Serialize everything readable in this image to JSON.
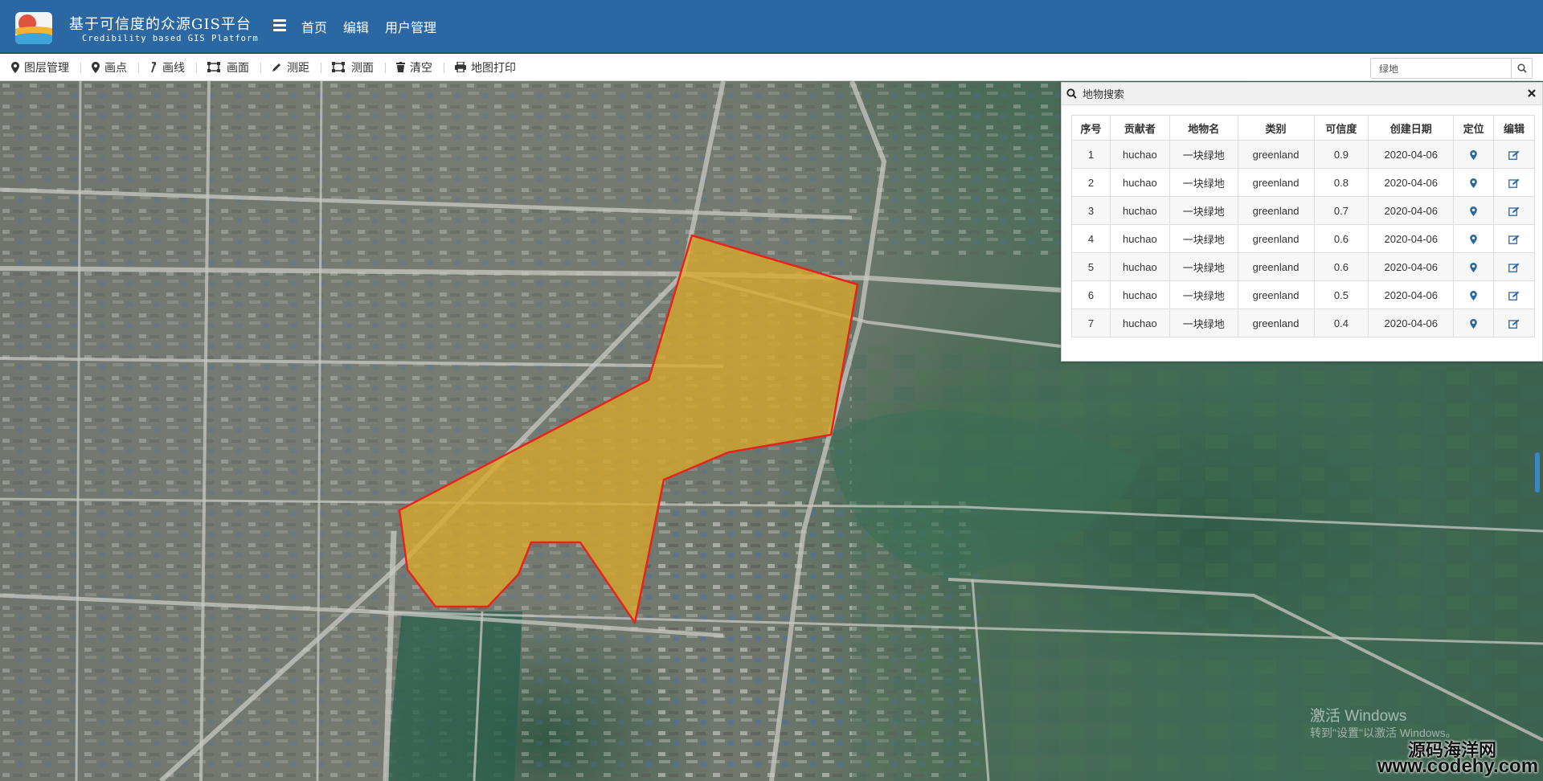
{
  "header": {
    "title_cn": "基于可信度的众源GIS平台",
    "title_en": "Credibility based GIS Platform",
    "nav": [
      "首页",
      "编辑",
      "用户管理"
    ]
  },
  "toolbar": {
    "tools": [
      {
        "label": "图层管理",
        "icon": "map-marker-icon"
      },
      {
        "label": "画点",
        "icon": "map-marker-icon"
      },
      {
        "label": "画线",
        "icon": "polyline-icon"
      },
      {
        "label": "画面",
        "icon": "polygon-icon"
      },
      {
        "label": "测距",
        "icon": "pencil-icon"
      },
      {
        "label": "测面",
        "icon": "polygon-icon"
      },
      {
        "label": "清空",
        "icon": "trash-icon"
      },
      {
        "label": "地图打印",
        "icon": "print-icon"
      }
    ],
    "search": {
      "value": "绿地"
    }
  },
  "panel": {
    "title": "地物搜索",
    "columns": [
      "序号",
      "贡献者",
      "地物名",
      "类别",
      "可信度",
      "创建日期",
      "定位",
      "编辑"
    ],
    "rows": [
      {
        "id": "1",
        "contributor": "huchao",
        "name": "一块绿地",
        "category": "greenland",
        "credibility": "0.9",
        "date": "2020-04-06"
      },
      {
        "id": "2",
        "contributor": "huchao",
        "name": "一块绿地",
        "category": "greenland",
        "credibility": "0.8",
        "date": "2020-04-06"
      },
      {
        "id": "3",
        "contributor": "huchao",
        "name": "一块绿地",
        "category": "greenland",
        "credibility": "0.7",
        "date": "2020-04-06"
      },
      {
        "id": "4",
        "contributor": "huchao",
        "name": "一块绿地",
        "category": "greenland",
        "credibility": "0.6",
        "date": "2020-04-06"
      },
      {
        "id": "5",
        "contributor": "huchao",
        "name": "一块绿地",
        "category": "greenland",
        "credibility": "0.6",
        "date": "2020-04-06"
      },
      {
        "id": "6",
        "contributor": "huchao",
        "name": "一块绿地",
        "category": "greenland",
        "credibility": "0.5",
        "date": "2020-04-06"
      },
      {
        "id": "7",
        "contributor": "huchao",
        "name": "一块绿地",
        "category": "greenland",
        "credibility": "0.4",
        "date": "2020-04-06"
      }
    ]
  },
  "watermark": {
    "line1": "激活 Windows",
    "line2": "转到\"设置\"以激活 Windows。"
  },
  "site": {
    "name": "源码海洋网",
    "url": "www.codehy.com"
  },
  "colors": {
    "header": "#2a67a3",
    "polygon_fill": "#d9a829",
    "polygon_stroke": "#e8231b",
    "icon_blue": "#2a67a3"
  }
}
